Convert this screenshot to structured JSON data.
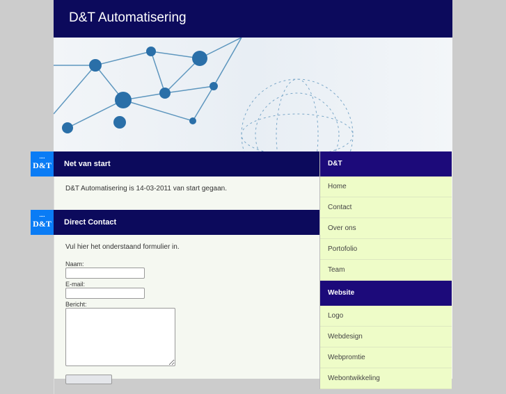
{
  "header": {
    "title": "D&T Automatisering"
  },
  "badge": {
    "dots": "....",
    "text": "D&T"
  },
  "sections": [
    {
      "title": "Net van start",
      "body": "D&T Automatisering is 14-03-2011 van start gegaan."
    },
    {
      "title": "Direct Contact",
      "body": "Vul hier het onderstaand formulier in."
    }
  ],
  "form": {
    "name_label": "Naam:",
    "email_label": "E-mail:",
    "message_label": "Bericht:",
    "name_value": "",
    "email_value": "",
    "submit_label": ""
  },
  "sidebar": {
    "groups": [
      {
        "title": "D&T",
        "items": [
          "Home",
          "Contact",
          "Over ons",
          "Portofolio",
          "Team"
        ]
      },
      {
        "title": "Website",
        "items": [
          "Logo",
          "Webdesign",
          "Webpromtie",
          "Webontwikkeling"
        ]
      }
    ]
  },
  "colors": {
    "header": "#0c0a5c",
    "sidebar_header": "#1c0a7a",
    "badge": "#0a7cf5",
    "sidebar_item": "#eefcc8"
  }
}
